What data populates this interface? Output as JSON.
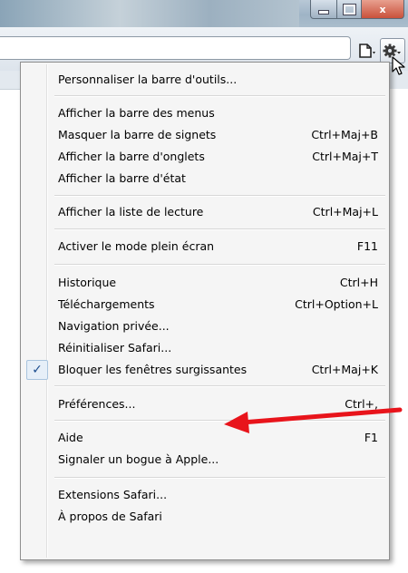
{
  "window": {
    "controls": {
      "minimize_icon": "minimize-icon",
      "maximize_icon": "maximize-icon",
      "close_label": "x"
    }
  },
  "toolbar": {
    "page_icon": "page-menu-icon",
    "gear_icon": "gear-icon"
  },
  "menu": {
    "items": [
      {
        "label": "Personnaliser la barre d'outils...",
        "shortcut": ""
      },
      {
        "label": "Afficher la barre des menus",
        "shortcut": ""
      },
      {
        "label": "Masquer la barre de signets",
        "shortcut": "Ctrl+Maj+B"
      },
      {
        "label": "Afficher la barre d'onglets",
        "shortcut": "Ctrl+Maj+T"
      },
      {
        "label": "Afficher la barre d'état",
        "shortcut": ""
      },
      {
        "label": "Afficher la liste de lecture",
        "shortcut": "Ctrl+Maj+L"
      },
      {
        "label": "Activer le mode plein écran",
        "shortcut": "F11"
      },
      {
        "label": "Historique",
        "shortcut": "Ctrl+H"
      },
      {
        "label": "Téléchargements",
        "shortcut": "Ctrl+Option+L"
      },
      {
        "label": "Navigation privée...",
        "shortcut": ""
      },
      {
        "label": "Réinitialiser Safari...",
        "shortcut": ""
      },
      {
        "label": "Bloquer les fenêtres surgissantes",
        "shortcut": "Ctrl+Maj+K",
        "checked": true
      },
      {
        "label": "Préférences...",
        "shortcut": "Ctrl+,"
      },
      {
        "label": "Aide",
        "shortcut": "F1"
      },
      {
        "label": "Signaler un bogue à Apple...",
        "shortcut": ""
      },
      {
        "label": "Extensions Safari...",
        "shortcut": ""
      },
      {
        "label": "À propos de Safari",
        "shortcut": ""
      }
    ],
    "check_mark": "✓"
  },
  "annotation": {
    "arrow_color": "#e8141b",
    "points_to": "Préférences..."
  }
}
